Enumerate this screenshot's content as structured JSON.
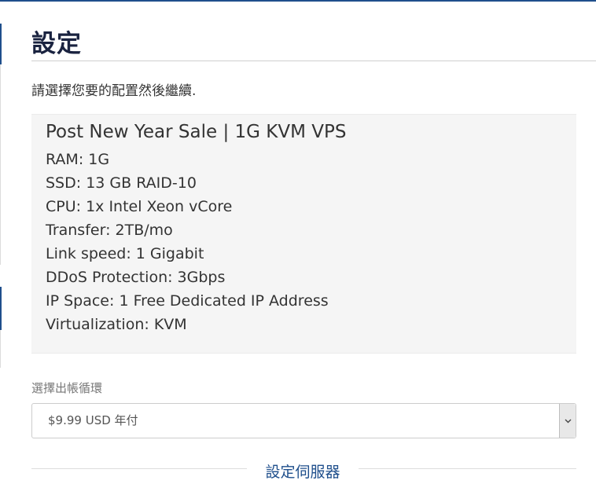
{
  "page": {
    "title": "設定",
    "intro": "請選擇您要的配置然後繼續."
  },
  "product": {
    "name": "Post New Year Sale | 1G KVM VPS",
    "specs": [
      "RAM: 1G",
      "SSD: 13 GB RAID-10",
      "CPU: 1x Intel Xeon vCore",
      "Transfer: 2TB/mo",
      "Link speed: 1 Gigabit",
      "DDoS Protection: 3Gbps",
      "IP Space: 1 Free Dedicated IP Address",
      "Virtualization: KVM"
    ]
  },
  "billing": {
    "label": "選擇出帳循環",
    "selected": "$9.99 USD 年付",
    "icon": "chevron-down-icon"
  },
  "server_section": {
    "title": "設定伺服器"
  },
  "colors": {
    "accent": "#1f4f8c",
    "title": "#1a2340",
    "panel_bg": "#f5f5f5"
  }
}
